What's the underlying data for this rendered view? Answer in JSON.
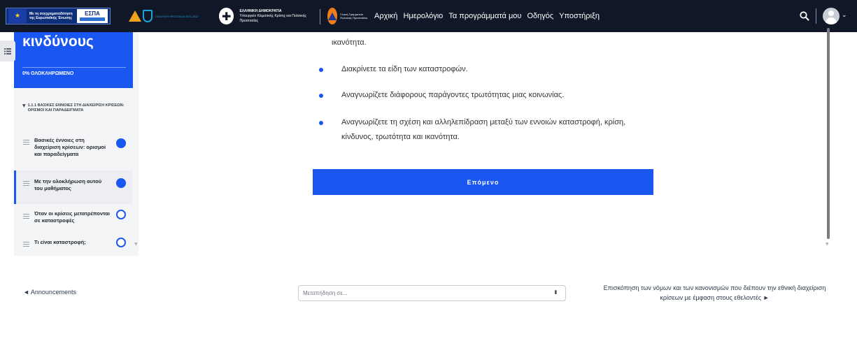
{
  "navbar": {
    "eu_logo_text": "Με τη συγχρηματοδότηση της Ευρωπαϊκής Ένωσης",
    "espa_label": "ΕΣΠΑ",
    "program_logo_text": "ΠΟΛΙΤΙΚΗ ΠΡΟΣΤΑΣΙΑ 2021-2027",
    "gov_title": "ΕΛΛΗΝΙΚΗ ΔΗΜΟΚΡΑΤΙΑ",
    "gov_ministry": "Υπουργείο Κλιματικής Κρίσης και Πολιτικής Προστασίας",
    "civil_protection_text": "Γενική Γραμματεία Πολιτικής Προστασίας",
    "links": [
      "Αρχική",
      "Ημερολόγιο",
      "Τα προγράμματά μου",
      "Οδηγός",
      "Υποστήριξη"
    ],
    "search_icon": "search-icon",
    "avatar_icon": "user-avatar-icon"
  },
  "course_index": {
    "title": "κινδύνους",
    "progress": "0% ΟΛΟΚΛΗΡΩΜΕΝΟ",
    "section_heading": "1.1.1 ΒΑΣΙΚΕΣ ΕΝΝΟΙΕΣ ΣΤΗ ΔΙΑΧΕΙΡΙΣΗ ΚΡΙΣΕΩΝ: ΟΡΙΣΜΟΙ ΚΑΙ ΠΑΡΑΔΕΙΓΜΑΤΑ",
    "items": [
      {
        "label": "Βασικές έννοιες στη διαχείριση κρίσεων: ορισμοί και παραδείγματα",
        "status": "viewed",
        "active": false
      },
      {
        "label": "Με την ολοκλήρωση αυτού του μαθήματος",
        "status": "viewed",
        "active": true
      },
      {
        "label": "Όταν οι κρίσεις μετατρέπονται σε καταστροφές",
        "status": "not-viewed",
        "active": false
      },
      {
        "label": "Τι είναι καταστροφή;",
        "status": "not-viewed",
        "active": false
      }
    ]
  },
  "content": {
    "partial_line": "ικανότητα.",
    "bullets": [
      "Διακρίνετε τα είδη των καταστροφών.",
      "Αναγνωρίζετε διάφορους παράγοντες τρωτότητας μιας κοινωνίας.",
      "Αναγνωρίζετε τη σχέση και αλληλεπίδραση μεταξύ των εννοιών καταστροφή, κρίση,",
      "κίνδυνος, τρωτότητα και ικανότητα."
    ],
    "next_button": "Επόμενο"
  },
  "activity_nav": {
    "prev_link": "◄ Announcements",
    "jump_placeholder": "Μεταπήδηση σε...",
    "next_link_line1": "Επισκόπηση των νόμων και των κανονισμών που διέπουν την εθνική διαχείριση",
    "next_link_line2": "κρίσεων με έμφαση στους εθελοντές ►"
  },
  "colors": {
    "navbar": "#101828",
    "accent": "#1a56f0",
    "drawer_bg": "#f4f5f7"
  }
}
